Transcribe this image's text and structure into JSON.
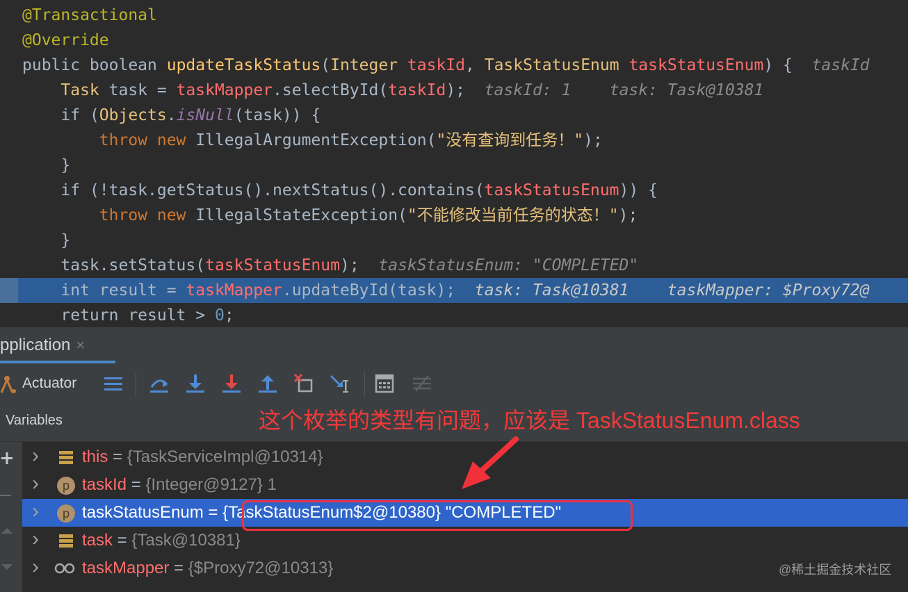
{
  "editor": {
    "lines": [
      {
        "tokens": [
          {
            "c": "anno",
            "t": "@Transactional"
          }
        ]
      },
      {
        "tokens": [
          {
            "c": "anno",
            "t": "@Override"
          }
        ]
      },
      {
        "tokens": [
          {
            "c": "kw2",
            "t": "public boolean "
          },
          {
            "c": "method",
            "t": "updateTaskStatus"
          },
          {
            "c": "plain",
            "t": "("
          },
          {
            "c": "y",
            "t": "Integer "
          },
          {
            "c": "param",
            "t": "taskId"
          },
          {
            "c": "plain",
            "t": ", "
          },
          {
            "c": "y",
            "t": "TaskStatusEnum "
          },
          {
            "c": "param",
            "t": "taskStatusEnum"
          },
          {
            "c": "plain",
            "t": ") {  "
          },
          {
            "c": "hint",
            "t": "taskId"
          }
        ]
      },
      {
        "tokens": [
          {
            "c": "y",
            "t": "    Task "
          },
          {
            "c": "plain",
            "t": "task = "
          },
          {
            "c": "field",
            "t": "taskMapper"
          },
          {
            "c": "plain",
            "t": ".selectById("
          },
          {
            "c": "param",
            "t": "taskId"
          },
          {
            "c": "plain",
            "t": ");  "
          },
          {
            "c": "hint",
            "t": "taskId: 1    task: Task@10381"
          }
        ]
      },
      {
        "tokens": [
          {
            "c": "kw2",
            "t": "    if "
          },
          {
            "c": "plain",
            "t": "("
          },
          {
            "c": "y",
            "t": "Objects"
          },
          {
            "c": "plain",
            "t": "."
          },
          {
            "c": "static",
            "t": "isNull"
          },
          {
            "c": "plain",
            "t": "(task)) {"
          }
        ]
      },
      {
        "tokens": [
          {
            "c": "kw",
            "t": "        throw new "
          },
          {
            "c": "plain",
            "t": "IllegalArgumentException("
          },
          {
            "c": "y",
            "t": "\"没有查询到任务！\""
          },
          {
            "c": "plain",
            "t": ");"
          }
        ]
      },
      {
        "tokens": [
          {
            "c": "plain",
            "t": "    }"
          }
        ]
      },
      {
        "tokens": [
          {
            "c": "kw2",
            "t": "    if "
          },
          {
            "c": "plain",
            "t": "(!task.getStatus().nextStatus().contains("
          },
          {
            "c": "param",
            "t": "taskStatusEnum"
          },
          {
            "c": "plain",
            "t": ")) {"
          }
        ]
      },
      {
        "tokens": [
          {
            "c": "kw",
            "t": "        throw new "
          },
          {
            "c": "plain",
            "t": "IllegalStateException("
          },
          {
            "c": "y",
            "t": "\"不能修改当前任务的状态！\""
          },
          {
            "c": "plain",
            "t": ");"
          }
        ]
      },
      {
        "tokens": [
          {
            "c": "plain",
            "t": "    }"
          }
        ]
      },
      {
        "tokens": [
          {
            "c": "plain",
            "t": "    task.setStatus("
          },
          {
            "c": "param",
            "t": "taskStatusEnum"
          },
          {
            "c": "plain",
            "t": ");  "
          },
          {
            "c": "hint",
            "t": "taskStatusEnum: \"COMPLETED\""
          }
        ]
      },
      {
        "exec": true,
        "tokens": [
          {
            "c": "kw2",
            "t": "    int "
          },
          {
            "c": "plain",
            "t": "result = "
          },
          {
            "c": "field",
            "t": "taskMapper"
          },
          {
            "c": "plain",
            "t": ".updateById(task);  "
          },
          {
            "c": "hint2",
            "t": "task: Task@10381    taskMapper: $Proxy72@"
          }
        ]
      },
      {
        "tokens": [
          {
            "c": "kw2",
            "t": "    return "
          },
          {
            "c": "plain",
            "t": "result > "
          },
          {
            "c": "num",
            "t": "0"
          },
          {
            "c": "plain",
            "t": ";"
          }
        ]
      }
    ]
  },
  "debug": {
    "tab_label": "pplication",
    "tab_close": "×",
    "actuator_label": "Actuator",
    "variables_label": "Variables",
    "annotation": "这个枚举的类型有问题，应该是 TaskStatusEnum.class",
    "watermark": "@稀土掘金技术社区",
    "variables": [
      {
        "icon": "field-icon",
        "name": "this",
        "value": "{TaskServiceImpl@10314}"
      },
      {
        "icon": "parameter-icon",
        "name": "taskId",
        "value": "{Integer@9127} 1"
      },
      {
        "icon": "parameter-icon",
        "name": "taskStatusEnum",
        "value": "{TaskStatusEnum$2@10380} \"COMPLETED\"",
        "selected": true
      },
      {
        "icon": "field-icon",
        "name": "task",
        "value": "{Task@10381}"
      },
      {
        "icon": "watch-icon",
        "name": "taskMapper",
        "value": "{$Proxy72@10313}"
      }
    ]
  },
  "colors": {
    "selection": "#2f65ca",
    "exec_line": "#2d5d96",
    "annotation": "#f13a3a"
  }
}
